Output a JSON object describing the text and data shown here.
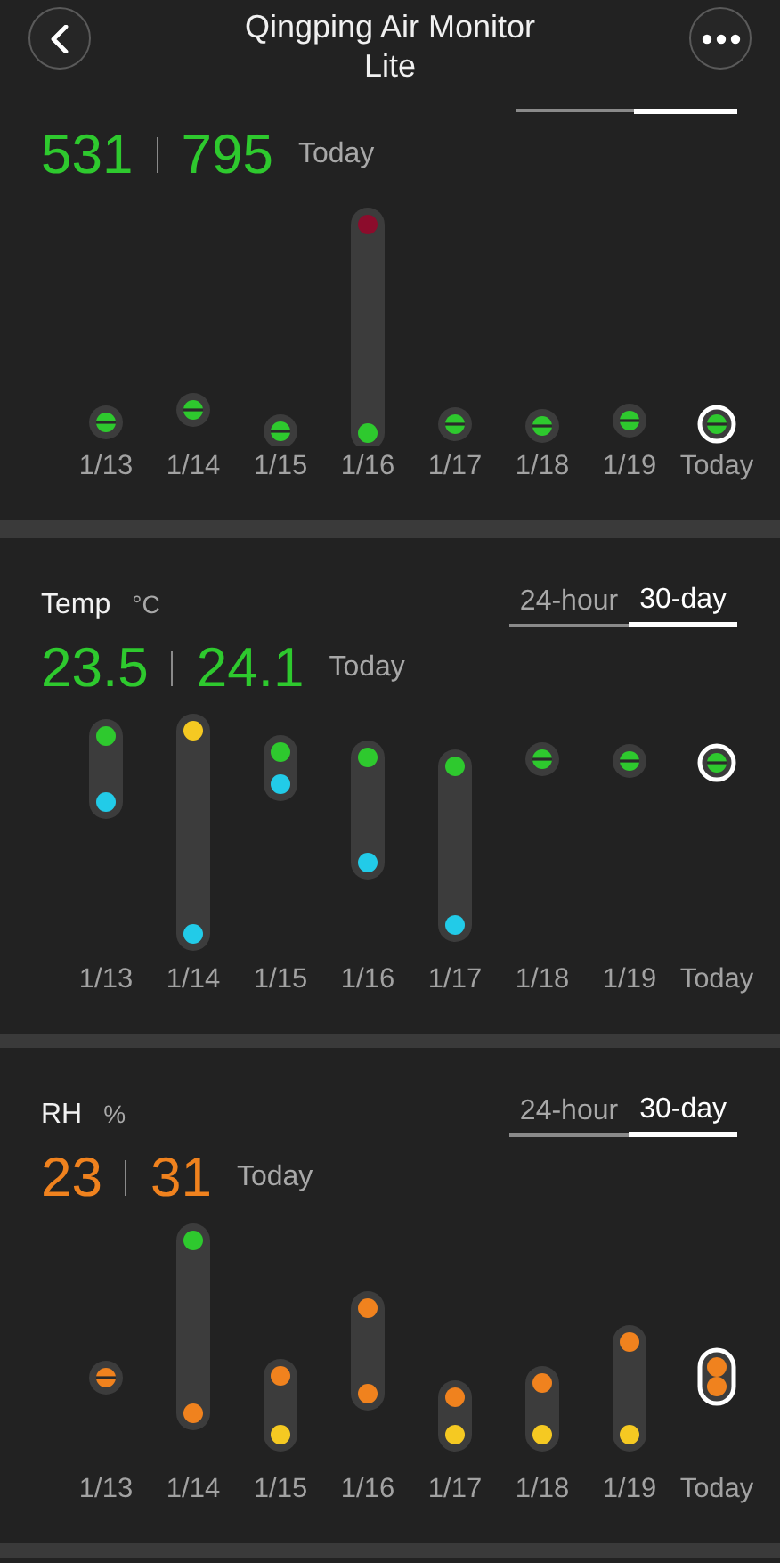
{
  "header": {
    "title": "Qingping Air Monitor Lite"
  },
  "sections": [
    {
      "tabs": [
        {
          "selected": false
        },
        {
          "selected": true
        }
      ],
      "values": [
        {
          "text": "531",
          "color": "#2ec92e"
        },
        {
          "text": "795",
          "color": "#2ec92e"
        }
      ],
      "today": "Today",
      "days": [
        {
          "label": "1/13",
          "selected": false
        },
        {
          "label": "1/14",
          "selected": false
        },
        {
          "label": "1/15",
          "selected": false
        },
        {
          "label": "1/16",
          "selected": false
        },
        {
          "label": "1/17",
          "selected": false
        },
        {
          "label": "1/18",
          "selected": false
        },
        {
          "label": "1/19",
          "selected": false
        },
        {
          "label": "Today",
          "selected": true
        }
      ]
    },
    {
      "title": "Temp",
      "unit": "°C",
      "tabs": [
        {
          "label": "24-hour",
          "selected": false
        },
        {
          "label": "30-day",
          "selected": true
        }
      ],
      "values": [
        {
          "text": "23.5",
          "color": "#2ec92e"
        },
        {
          "text": "24.1",
          "color": "#2ec92e"
        }
      ],
      "today": "Today",
      "days": [
        {
          "label": "1/13",
          "selected": false
        },
        {
          "label": "1/14",
          "selected": false
        },
        {
          "label": "1/15",
          "selected": false
        },
        {
          "label": "1/16",
          "selected": false
        },
        {
          "label": "1/17",
          "selected": false
        },
        {
          "label": "1/18",
          "selected": false
        },
        {
          "label": "1/19",
          "selected": false
        },
        {
          "label": "Today",
          "selected": true
        }
      ]
    },
    {
      "title": "RH",
      "unit": "%",
      "tabs": [
        {
          "label": "24-hour",
          "selected": false
        },
        {
          "label": "30-day",
          "selected": true
        }
      ],
      "values": [
        {
          "text": "23",
          "color": "#f0821e"
        },
        {
          "text": "31",
          "color": "#f0821e"
        }
      ],
      "today": "Today",
      "days": [
        {
          "label": "1/13",
          "selected": false
        },
        {
          "label": "1/14",
          "selected": false
        },
        {
          "label": "1/15",
          "selected": false
        },
        {
          "label": "1/16",
          "selected": false
        },
        {
          "label": "1/17",
          "selected": false
        },
        {
          "label": "1/18",
          "selected": false
        },
        {
          "label": "1/19",
          "selected": false
        },
        {
          "label": "Today",
          "selected": true
        }
      ]
    }
  ]
}
